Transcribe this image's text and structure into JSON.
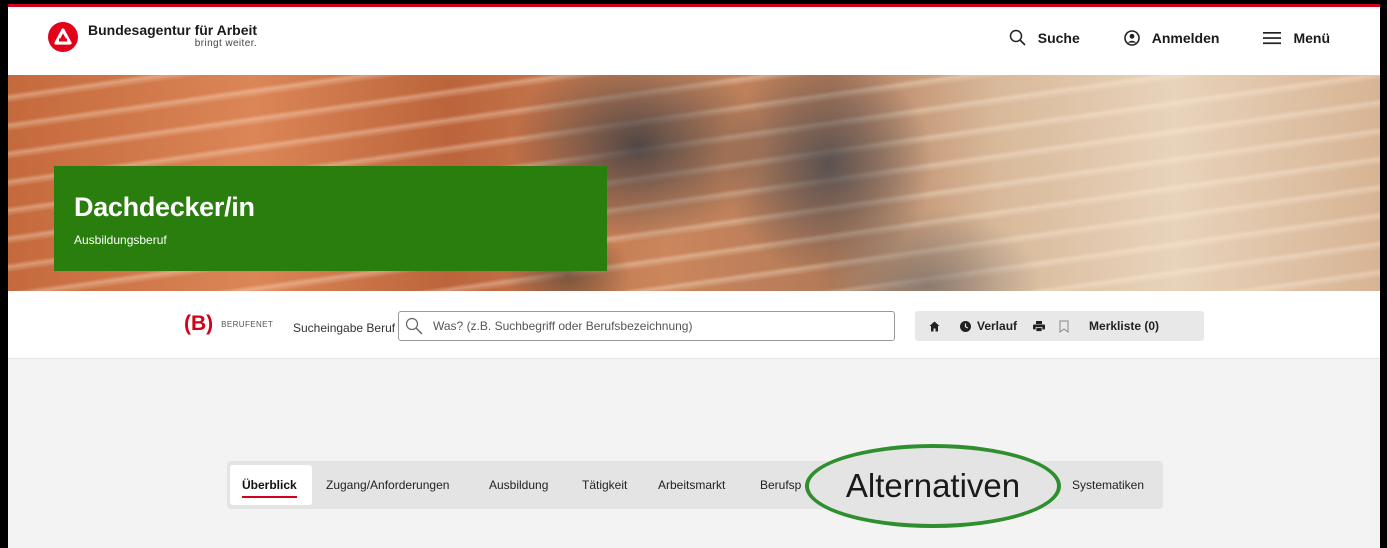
{
  "header": {
    "brand_title": "Bundesagentur für Arbeit",
    "brand_tagline": "bringt weiter.",
    "actions": [
      {
        "label": "Suche",
        "icon": "search-icon"
      },
      {
        "label": "Anmelden",
        "icon": "user-icon"
      },
      {
        "label": "Menü",
        "icon": "menu-icon"
      }
    ]
  },
  "hero": {
    "title": "Dachdecker/in",
    "subtitle": "Ausbildungsberuf",
    "card_color": "#2c7d12"
  },
  "berufenet": {
    "logo_letter": "(B)",
    "logo_name": "BERUFENET",
    "search_label": "Sucheingabe Beruf",
    "search_placeholder": "Was? (z.B. Suchbegriff oder Berufsbezeichnung)",
    "search_value": "",
    "tools": {
      "home_icon": "home-icon",
      "history_label": "Verlauf",
      "print_icon": "print-icon",
      "bookmark_icon": "bookmark-icon",
      "watchlist_label": "Merkliste (0)"
    }
  },
  "tabs": {
    "items": [
      {
        "label": "Überblick",
        "active": true
      },
      {
        "label": "Zugang/Anforderungen"
      },
      {
        "label": "Ausbildung"
      },
      {
        "label": "Tätigkeit"
      },
      {
        "label": "Arbeitsmarkt"
      },
      {
        "label": "Berufsp"
      },
      {
        "label": "Systematiken"
      }
    ],
    "highlighted_label": "Alternativen"
  },
  "colors": {
    "accent_red": "#d0021b",
    "highlight_green": "#2f8f2f"
  }
}
